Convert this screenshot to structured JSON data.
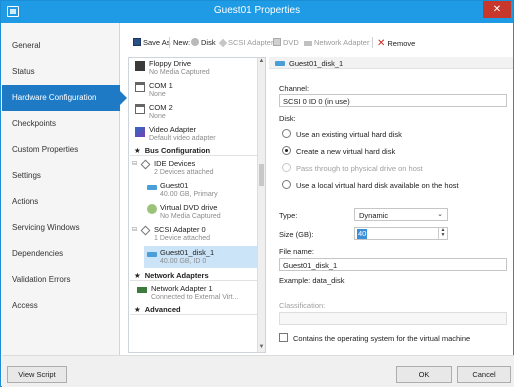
{
  "window": {
    "title": "Guest01 Properties",
    "close_glyph": "✕"
  },
  "sidebar": {
    "items": [
      {
        "label": "General"
      },
      {
        "label": "Status"
      },
      {
        "label": "Hardware Configuration"
      },
      {
        "label": "Checkpoints"
      },
      {
        "label": "Custom Properties"
      },
      {
        "label": "Settings"
      },
      {
        "label": "Actions"
      },
      {
        "label": "Servicing Windows"
      },
      {
        "label": "Dependencies"
      },
      {
        "label": "Validation Errors"
      },
      {
        "label": "Access"
      }
    ],
    "active": "Hardware Configuration"
  },
  "toolbar": {
    "save_as": "Save As",
    "new_label": "New:",
    "disk": "Disk",
    "scsi_adapter": "SCSI Adapter",
    "dvd": "DVD",
    "network_adapter": "Network Adapter",
    "remove": "Remove",
    "remove_glyph": "✕"
  },
  "tree": {
    "floppy": {
      "name": "Floppy Drive",
      "detail": "No Media Captured"
    },
    "com1": {
      "name": "COM 1",
      "detail": "None"
    },
    "com2": {
      "name": "COM 2",
      "detail": "None"
    },
    "video": {
      "name": "Video Adapter",
      "detail": "Default video adapter"
    },
    "bus_header": "Bus Configuration",
    "ide": {
      "name": "IDE Devices",
      "detail": "2 Devices attached"
    },
    "guest01": {
      "name": "Guest01",
      "detail": "40.00 GB, Primary"
    },
    "vdvd": {
      "name": "Virtual DVD drive",
      "detail": "No Media Captured"
    },
    "scsi": {
      "name": "SCSI Adapter 0",
      "detail": "1 Device attached"
    },
    "disk1": {
      "name": "Guest01_disk_1",
      "detail": "40.00 GB, ID 0"
    },
    "net_header": "Network Adapters",
    "net1": {
      "name": "Network Adapter 1",
      "detail": "Connected to External Virt..."
    },
    "adv_header": "Advanced",
    "star": "★",
    "collapse_glyph": "⊟",
    "scroll_up": "▲",
    "scroll_down": "▼"
  },
  "detail": {
    "header": "Guest01_disk_1",
    "channel_label": "Channel:",
    "channel_value": "SCSI 0 ID 0 (in use)",
    "disk_label": "Disk:",
    "options": [
      {
        "label": "Use an existing virtual hard disk",
        "selected": false,
        "enabled": true
      },
      {
        "label": "Create a new virtual hard disk",
        "selected": true,
        "enabled": true
      },
      {
        "label": "Pass through to physical drive on host",
        "selected": false,
        "enabled": false
      },
      {
        "label": "Use a local virtual hard disk available on the host",
        "selected": false,
        "enabled": true
      }
    ],
    "type_label": "Type:",
    "type_value": "Dynamic",
    "type_arrow": "⌄",
    "size_label": "Size (GB):",
    "size_value": "40",
    "spin_up": "▲",
    "spin_down": "▼",
    "filename_label": "File name:",
    "filename_value": "Guest01_disk_1",
    "example": "Example: data_disk",
    "classification_label": "Classification:",
    "classification_value": "",
    "contains_os_label": "Contains the operating system for the virtual machine",
    "contains_os_checked": false
  },
  "footer": {
    "view_script": "View Script",
    "ok": "OK",
    "cancel": "Cancel"
  }
}
